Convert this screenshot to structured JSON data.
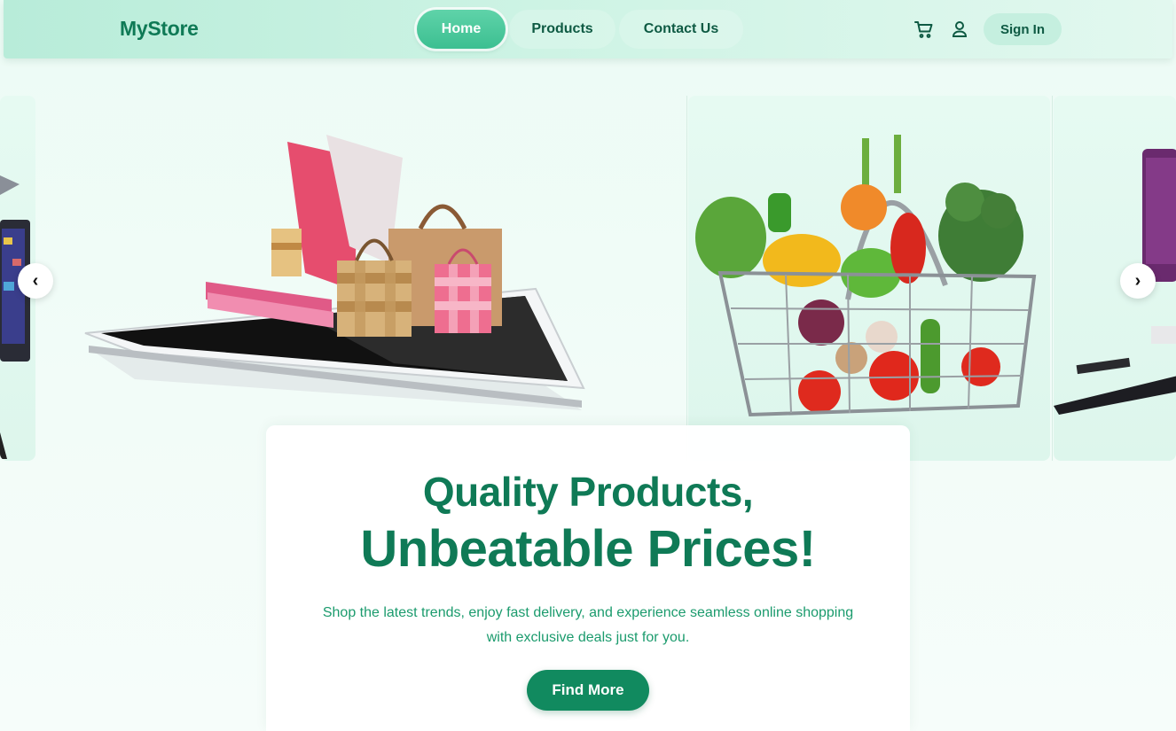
{
  "nav": {
    "brand": "MyStore",
    "links": [
      {
        "label": "Home",
        "active": true
      },
      {
        "label": "Products",
        "active": false
      },
      {
        "label": "Contact Us",
        "active": false
      }
    ],
    "icons": [
      "cart-icon",
      "user-icon"
    ],
    "signin_label": "Sign In"
  },
  "carousel": {
    "slides": [
      "tablet-shopping-bags-image",
      "vegetable-basket-image",
      "cosmetics-image"
    ],
    "prev_icon": "‹",
    "next_icon": "›"
  },
  "hero": {
    "headline_1": "Quality Products,",
    "headline_2": "Unbeatable Prices!",
    "subtitle": "Shop the latest trends, enjoy fast delivery, and experience seamless online shopping with exclusive deals just for you.",
    "cta_label": "Find More"
  },
  "colors": {
    "brand_green": "#0f7a56",
    "accent_mint": "#3cbf91",
    "cta_green": "#118a5f",
    "page_bg": "#ecfbf5"
  }
}
